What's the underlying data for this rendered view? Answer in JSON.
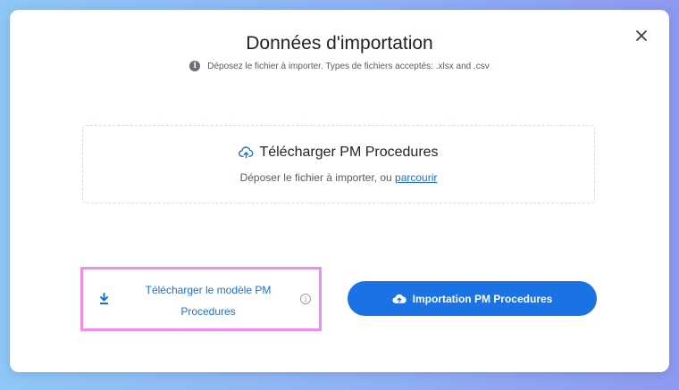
{
  "dialog": {
    "title": "Données d'importation",
    "subtitle": "Déposez le fichier à importer. Types de fichiers acceptés: .xlsx and .csv",
    "close_icon": "close-icon",
    "info_icon": "info-icon"
  },
  "dropzone": {
    "title": "Télécharger PM Procedures",
    "text": "Déposer le fichier à importer, ou",
    "browse_link": "parcourir",
    "icon": "cloud-upload-icon"
  },
  "template_download": {
    "label_line1": "Télécharger le modèle PM",
    "label_line2": "Procedures",
    "icon": "download-icon",
    "info_icon": "info-outline-icon",
    "highlight_color": "#f38af0"
  },
  "import_button": {
    "label": "Importation PM Procedures",
    "icon": "cloud-upload-icon",
    "color": "#1b72e4"
  }
}
